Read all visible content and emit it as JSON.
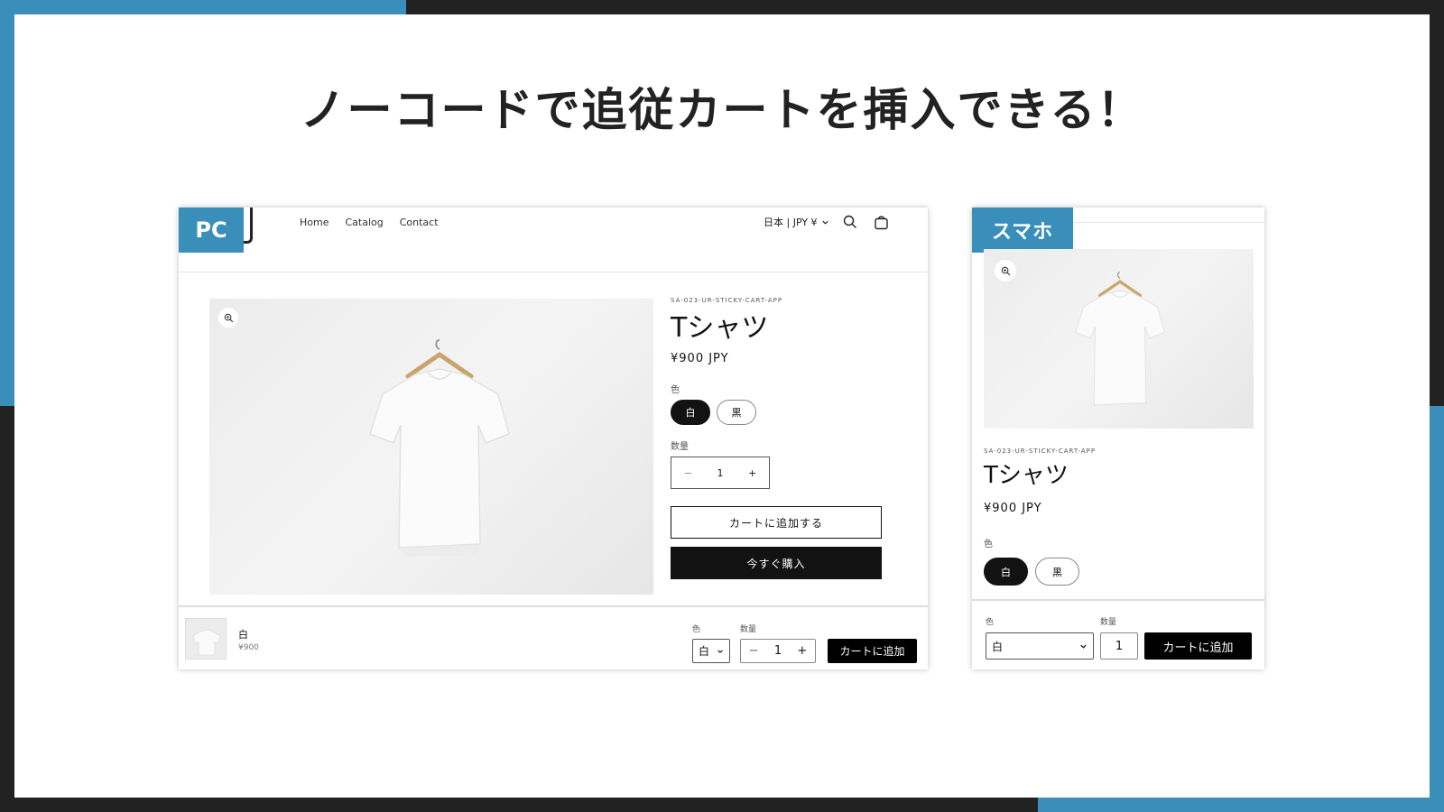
{
  "headline": "ノーコードで追従カートを挿入できる！",
  "pc": {
    "badge": "PC",
    "nav": [
      "Home",
      "Catalog",
      "Contact"
    ],
    "locale": "日本 | JPY ¥",
    "product": {
      "sku": "SA-023-UR-STICKY-CART-APP",
      "title": "Tシャツ",
      "price": "¥900 JPY",
      "color_label": "色",
      "colors": [
        "白",
        "黒"
      ],
      "selected_color": "白",
      "qty_label": "数量",
      "qty": "1",
      "add_to_cart": "カートに追加する",
      "buy_now": "今すぐ購入"
    },
    "sticky": {
      "variant": "白",
      "price": "¥900",
      "color_label": "色",
      "color_value": "白",
      "qty_label": "数量",
      "qty": "1",
      "add_button": "カートに追加"
    }
  },
  "sp": {
    "badge": "スマホ",
    "product": {
      "sku": "SA-023-UR-STICKY-CART-APP",
      "title": "Tシャツ",
      "price": "¥900 JPY",
      "color_label": "色",
      "colors": [
        "白",
        "黒"
      ]
    },
    "sticky": {
      "color_label": "色",
      "color_value": "白",
      "qty_label": "数量",
      "qty": "1",
      "add_button": "カートに追加"
    }
  },
  "icons": {
    "search": "search-icon",
    "cart": "cart-icon",
    "zoom": "zoom-icon",
    "chevron": "chevron-down-icon"
  },
  "colors": {
    "accent": "#3a8fba",
    "dark": "#222222",
    "button": "#121212"
  }
}
